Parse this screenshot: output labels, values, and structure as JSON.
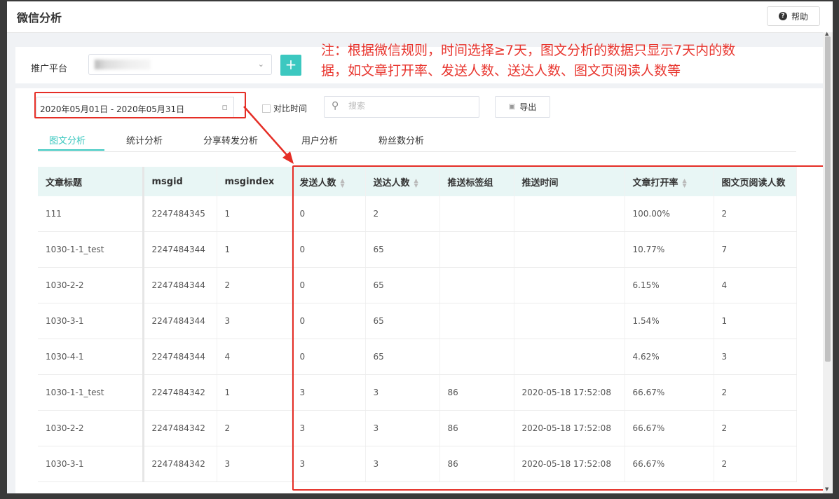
{
  "header": {
    "title": "微信分析",
    "help_label": "帮助"
  },
  "platform": {
    "label": "推广平台",
    "add_label": "+"
  },
  "annotation": {
    "note_line1": "注：根据微信规则，时间选择≥7天，图文分析的数据只显示7天内的数",
    "note_line2": "据，如文章打开率、发送人数、送达人数、图文页阅读人数等"
  },
  "toolbar": {
    "date_range": "2020年05月01日 - 2020年05月31日",
    "compare_label": "对比时间",
    "search_placeholder": "搜索",
    "export_label": "导出"
  },
  "tabs": [
    {
      "label": "图文分析"
    },
    {
      "label": "统计分析"
    },
    {
      "label": "分享转发分析"
    },
    {
      "label": "用户分析"
    },
    {
      "label": "粉丝数分析"
    }
  ],
  "table": {
    "headers": [
      "文章标题",
      "msgid",
      "msgindex",
      "发送人数",
      "送达人数",
      "推送标签组",
      "推送时间",
      "文章打开率",
      "图文页阅读人数"
    ],
    "rows": [
      [
        "111",
        "2247484345",
        "1",
        "0",
        "2",
        "",
        "",
        "100.00%",
        "2"
      ],
      [
        "1030-1-1_test",
        "2247484344",
        "1",
        "0",
        "65",
        "",
        "",
        "10.77%",
        "7"
      ],
      [
        "1030-2-2",
        "2247484344",
        "2",
        "0",
        "65",
        "",
        "",
        "6.15%",
        "4"
      ],
      [
        "1030-3-1",
        "2247484344",
        "3",
        "0",
        "65",
        "",
        "",
        "1.54%",
        "1"
      ],
      [
        "1030-4-1",
        "2247484344",
        "4",
        "0",
        "65",
        "",
        "",
        "4.62%",
        "3"
      ],
      [
        "1030-1-1_test",
        "2247484342",
        "1",
        "3",
        "3",
        "86",
        "2020-05-18 17:52:08",
        "66.67%",
        "2"
      ],
      [
        "1030-2-2",
        "2247484342",
        "2",
        "3",
        "3",
        "86",
        "2020-05-18 17:52:08",
        "66.67%",
        "2"
      ],
      [
        "1030-3-1",
        "2247484342",
        "3",
        "3",
        "3",
        "86",
        "2020-05-18 17:52:08",
        "66.67%",
        "2"
      ]
    ]
  },
  "colors": {
    "accent": "#3cc8c0",
    "annotation_red": "#e52e26",
    "header_bg": "#e8f6f5"
  }
}
